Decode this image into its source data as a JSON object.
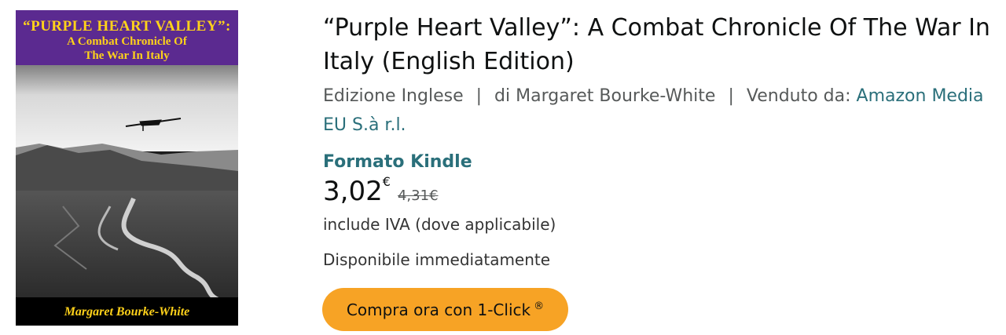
{
  "cover": {
    "title_line1": "“PURPLE HEART VALLEY”:",
    "title_line2": "A Combat Chronicle Of",
    "title_line3": "The War In Italy",
    "author": "Margaret Bourke-White",
    "band_color": "#5b2a90",
    "text_color": "#ffd21a"
  },
  "product": {
    "title": "“Purple Heart Valley”: A Combat Chronicle Of The War In Italy (English Edition)",
    "edition": "Edizione Inglese",
    "separator": "|",
    "author_label": "di Margaret Bourke-White",
    "seller_label": "Venduto da:",
    "seller_name": "Amazon Media EU S.à r.l.",
    "format": "Formato Kindle",
    "price_main": "3,02",
    "price_currency": "€",
    "old_price": "4,31€",
    "vat_note": "include IVA (dove applicabile)",
    "availability": "Disponibile immediatamente"
  },
  "buy_button": {
    "label": "Compra ora con 1-Click",
    "mark": "®",
    "color": "#f7a325"
  }
}
